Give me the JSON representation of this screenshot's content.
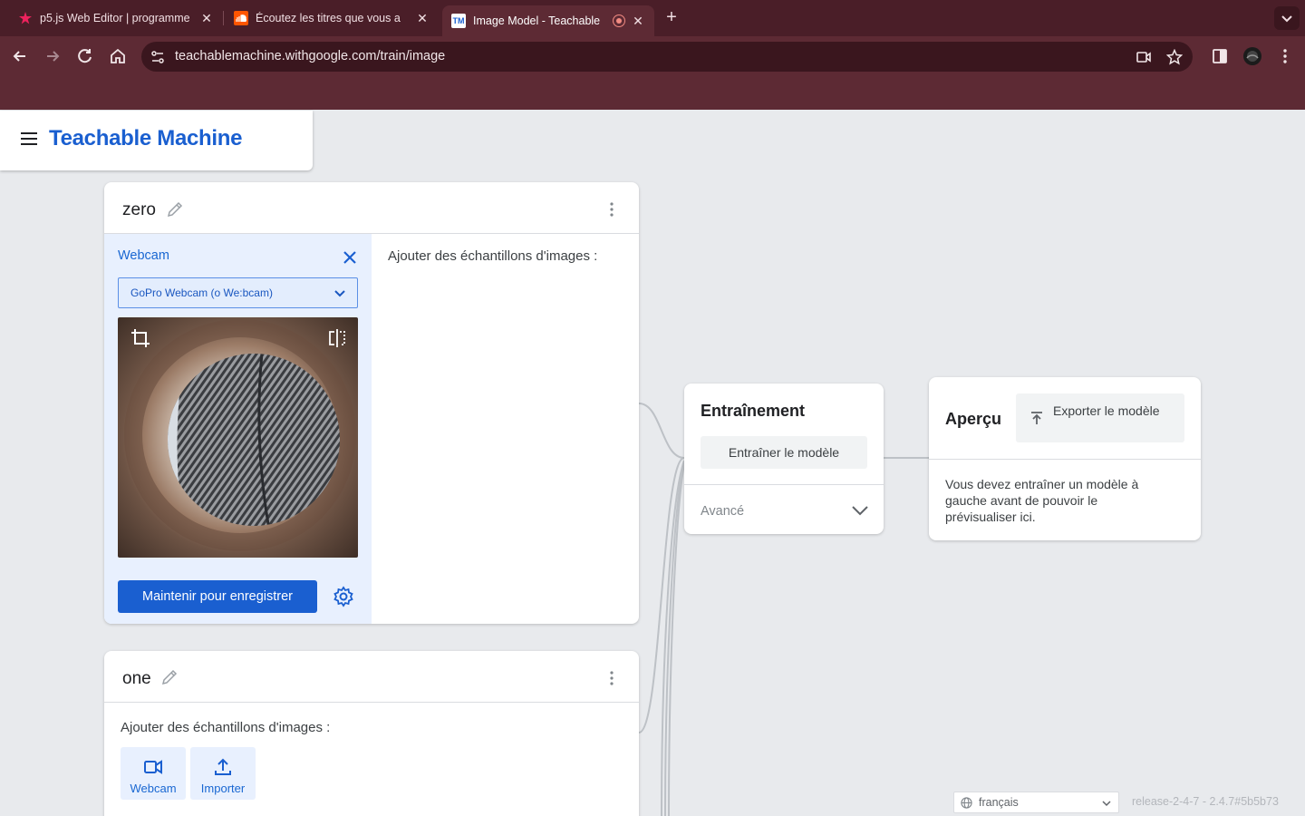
{
  "browser": {
    "tabs": [
      {
        "title": "p5.js Web Editor | programme",
        "icon": "p5js-icon"
      },
      {
        "title": "Écoutez les titres que vous a",
        "icon": "soundcloud-icon"
      },
      {
        "title": "Image Model - Teachable",
        "icon": "tm-icon",
        "badge": "TM"
      }
    ],
    "url": "teachablemachine.withgoogle.com/train/image"
  },
  "app": {
    "brand": "Teachable Machine"
  },
  "classes": [
    {
      "name": "zero",
      "webcam_label": "Webcam",
      "camera_select": "GoPro Webcam (o We:bcam)",
      "record_label": "Maintenir pour enregistrer",
      "samples_label": "Ajouter des échantillons d'images :"
    },
    {
      "name": "one",
      "samples_label": "Ajouter des échantillons d'images :",
      "webcam_btn": "Webcam",
      "import_btn": "Importer"
    }
  ],
  "training": {
    "title": "Entraînement",
    "train_button": "Entraîner le modèle",
    "advanced": "Avancé"
  },
  "preview": {
    "title": "Aperçu",
    "export_button": "Exporter le modèle",
    "message": "Vous devez entraîner un modèle à gauche avant de pouvoir le prévisualiser ici."
  },
  "footer": {
    "language": "français",
    "release": "release-2-4-7 - 2.4.7#5b5b73"
  },
  "colors": {
    "accent": "#1a5fd0",
    "chrome": "#5d2a34",
    "tabbar": "#4a1e28"
  }
}
